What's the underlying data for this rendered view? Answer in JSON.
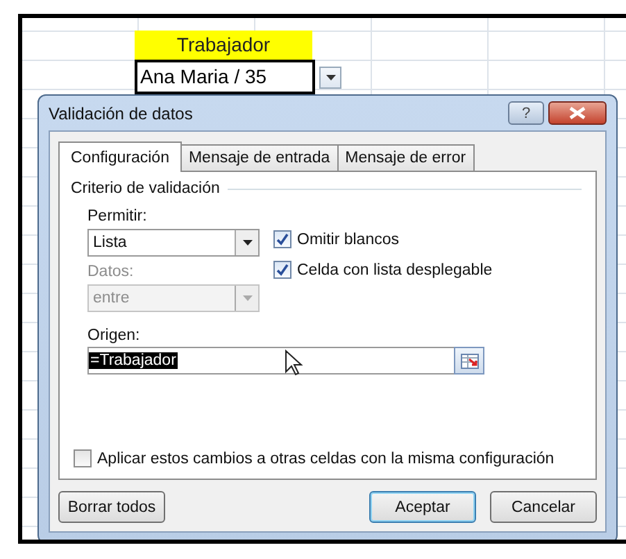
{
  "sheet": {
    "header_cell": "Trabajador",
    "active_cell": "Ana Maria / 35"
  },
  "dialog": {
    "title": "Validación de datos",
    "help_label": "?",
    "tabs": [
      {
        "label": "Configuración",
        "selected": true
      },
      {
        "label": "Mensaje de entrada",
        "selected": false
      },
      {
        "label": "Mensaje de error",
        "selected": false
      }
    ],
    "section_title": "Criterio de validación",
    "allow": {
      "label": "Permitir:",
      "value": "Lista",
      "disabled": false
    },
    "data": {
      "label": "Datos:",
      "value": "entre",
      "disabled": true
    },
    "options": [
      {
        "label": "Omitir blancos",
        "checked": true
      },
      {
        "label": "Celda con lista desplegable",
        "checked": true
      }
    ],
    "source": {
      "label": "Origen:",
      "value": "=Trabajador",
      "selected": true
    },
    "apply_all": {
      "label": "Aplicar estos cambios a otras celdas con la misma configuración",
      "checked": false
    },
    "buttons": [
      {
        "label": "Borrar todos",
        "kind": "left",
        "default": false
      },
      {
        "label": "Aceptar",
        "kind": "right",
        "default": true
      },
      {
        "label": "Cancelar",
        "kind": "right",
        "default": false
      }
    ]
  }
}
